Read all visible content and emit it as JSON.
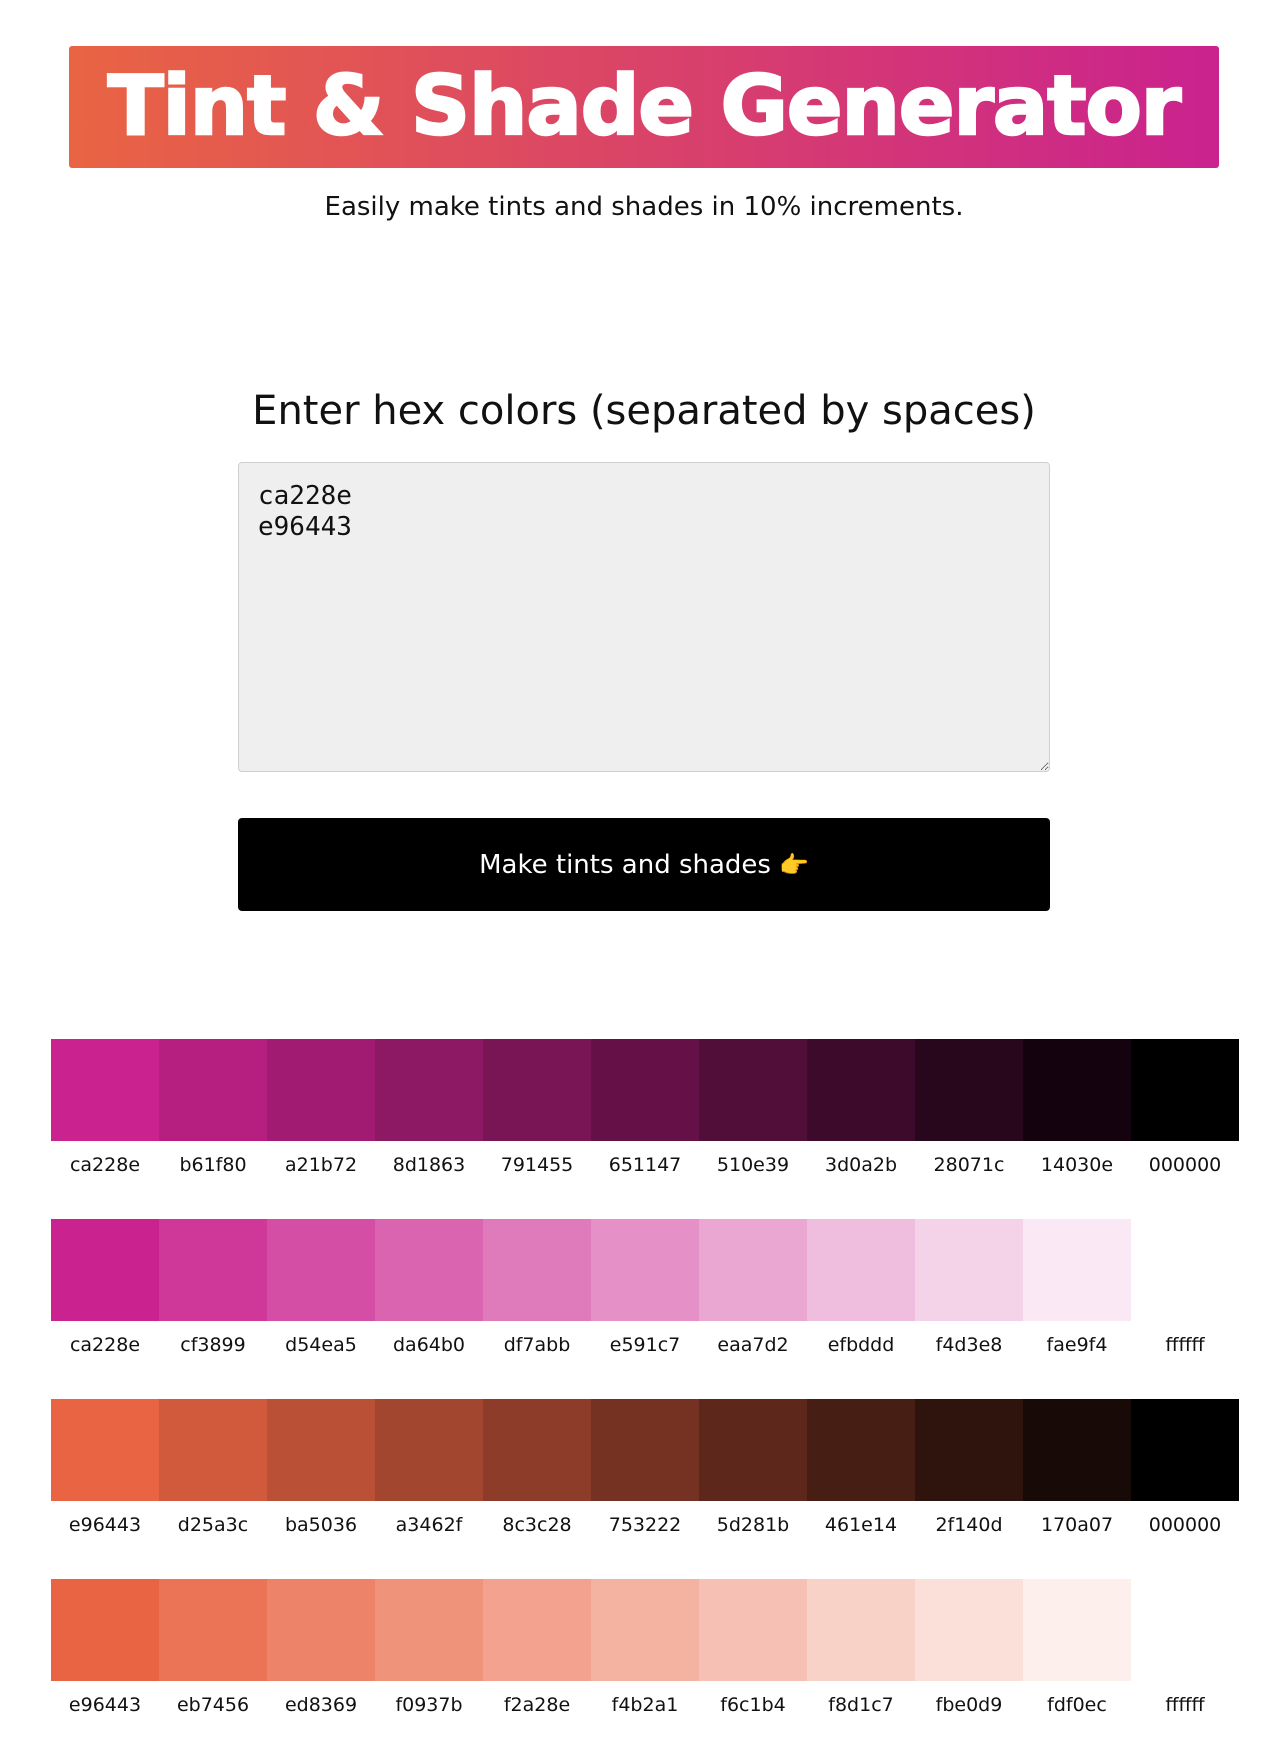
{
  "header": {
    "title": "Tint & Shade Generator",
    "subtitle": "Easily make tints and shades in 10% increments."
  },
  "form": {
    "prompt": "Enter hex colors (separated by spaces)",
    "input_value": "ca228e\ne96443",
    "button_label": "Make tints and shades",
    "button_emoji": "👉"
  },
  "colors": {
    "gradient_start": "#e96443",
    "gradient_end": "#ca228e"
  },
  "palettes": [
    {
      "kind": "shades",
      "base": "ca228e",
      "swatches": [
        "ca228e",
        "b61f80",
        "a21b72",
        "8d1863",
        "791455",
        "651147",
        "510e39",
        "3d0a2b",
        "28071c",
        "14030e",
        "000000"
      ]
    },
    {
      "kind": "tints",
      "base": "ca228e",
      "swatches": [
        "ca228e",
        "cf3899",
        "d54ea5",
        "da64b0",
        "df7abb",
        "e591c7",
        "eaa7d2",
        "efbddd",
        "f4d3e8",
        "fae9f4",
        "ffffff"
      ]
    },
    {
      "kind": "shades",
      "base": "e96443",
      "swatches": [
        "e96443",
        "d25a3c",
        "ba5036",
        "a3462f",
        "8c3c28",
        "753222",
        "5d281b",
        "461e14",
        "2f140d",
        "170a07",
        "000000"
      ]
    },
    {
      "kind": "tints",
      "base": "e96443",
      "swatches": [
        "e96443",
        "eb7456",
        "ed8369",
        "f0937b",
        "f2a28e",
        "f4b2a1",
        "f6c1b4",
        "f8d1c7",
        "fbe0d9",
        "fdf0ec",
        "ffffff"
      ]
    }
  ]
}
